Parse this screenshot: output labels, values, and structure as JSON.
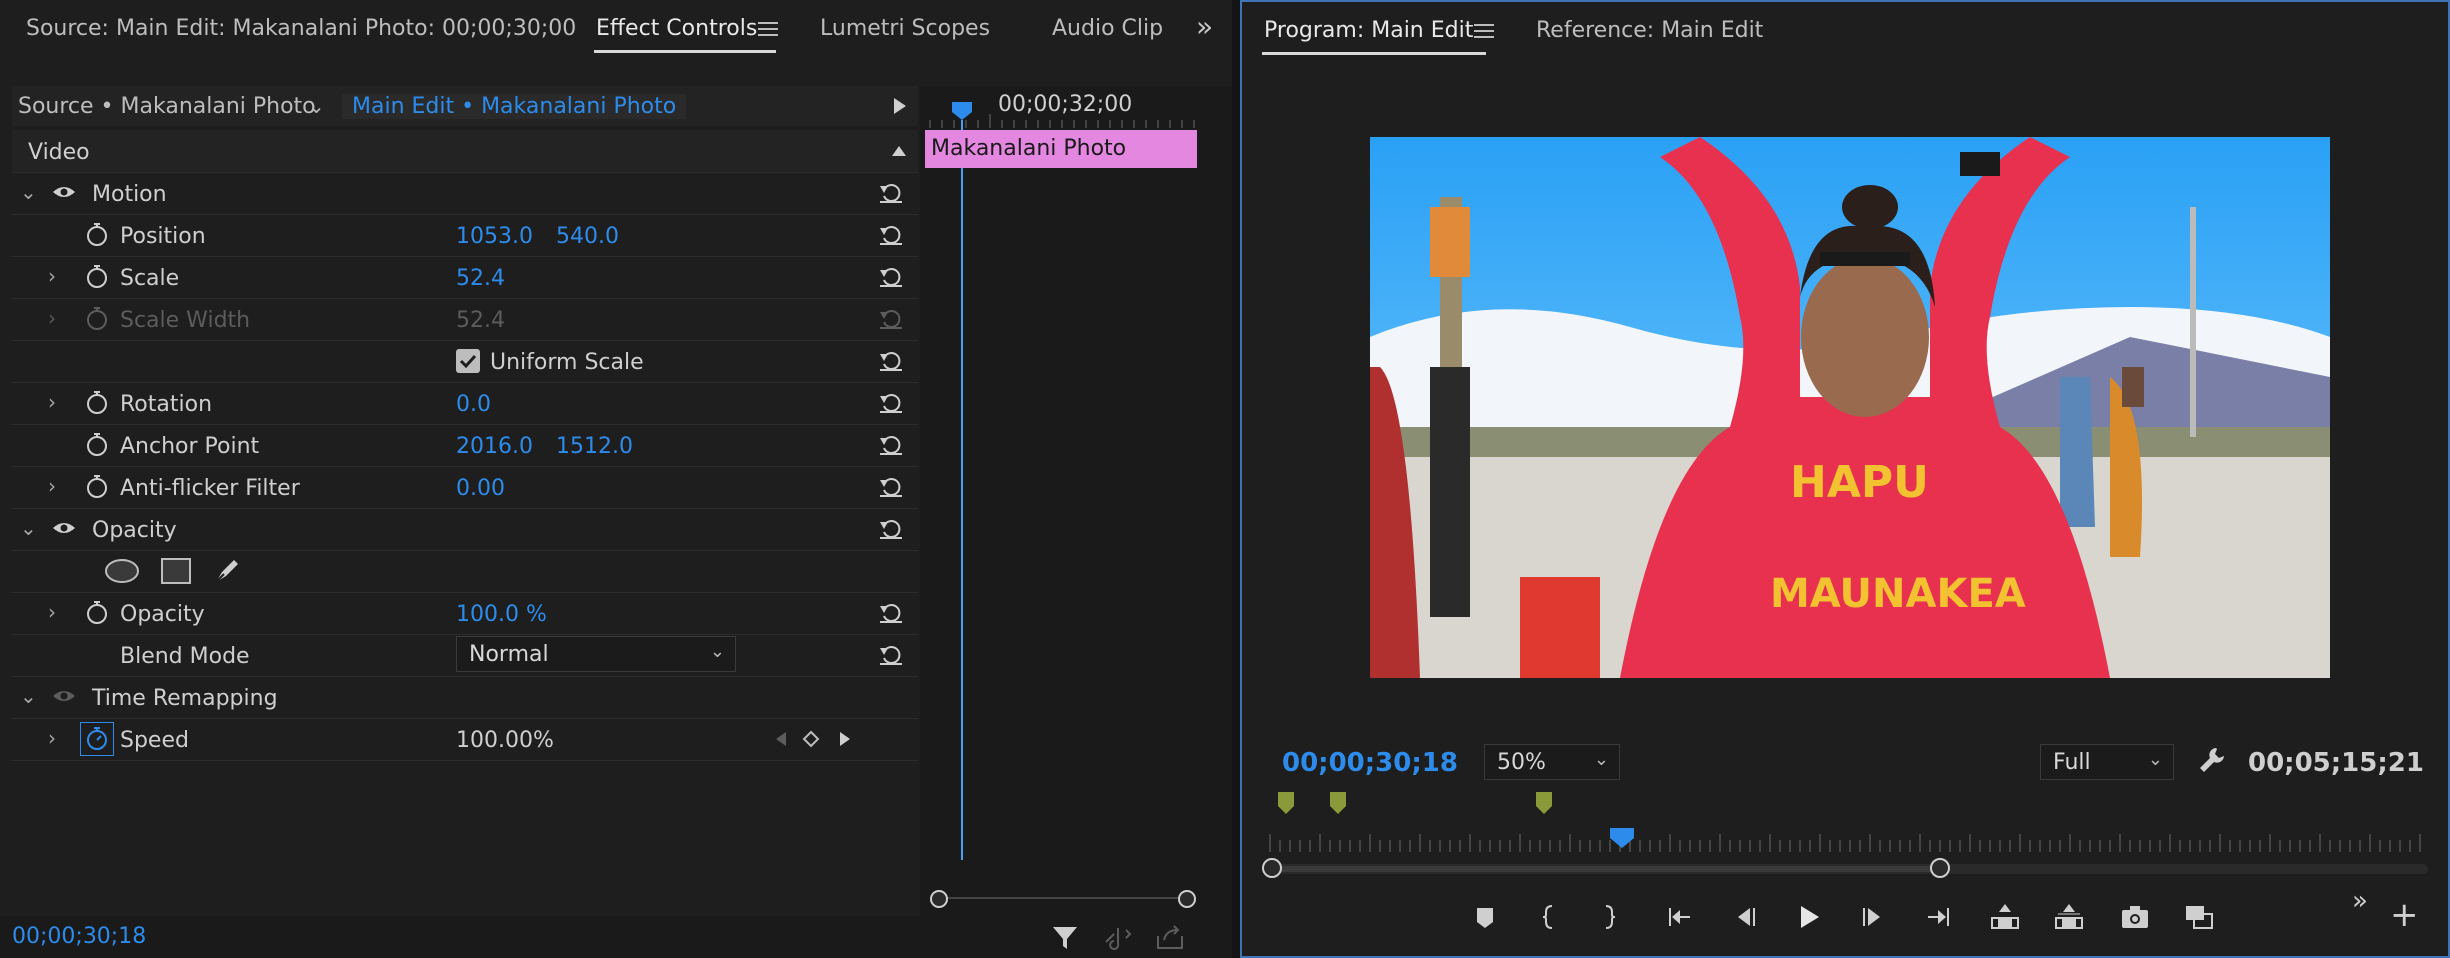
{
  "left_panel": {
    "tabs": [
      {
        "label": "Source: Main Edit: Makanalani Photo: 00;00;30;00",
        "active": false
      },
      {
        "label": "Effect Controls",
        "active": true
      },
      {
        "label": "Lumetri Scopes",
        "active": false
      },
      {
        "label": "Audio Clip",
        "active": false
      }
    ],
    "overflow_icon": "double-chevron-right-icon",
    "source_label": "Source • Makanalani Photo",
    "sequence_label": "Main Edit • Makanalani Photo",
    "section_video": "Video",
    "effects": {
      "motion": {
        "label": "Motion",
        "position": {
          "label": "Position",
          "x": "1053.0",
          "y": "540.0"
        },
        "scale": {
          "label": "Scale",
          "value": "52.4"
        },
        "scale_width": {
          "label": "Scale Width",
          "value": "52.4"
        },
        "uniform_scale": {
          "label": "Uniform Scale",
          "checked": true
        },
        "rotation": {
          "label": "Rotation",
          "value": "0.0"
        },
        "anchor_point": {
          "label": "Anchor Point",
          "x": "2016.0",
          "y": "1512.0"
        },
        "anti_flicker": {
          "label": "Anti-flicker Filter",
          "value": "0.00"
        }
      },
      "opacity": {
        "label": "Opacity",
        "opacity": {
          "label": "Opacity",
          "value": "100.0 %"
        },
        "blend_mode": {
          "label": "Blend Mode",
          "value": "Normal"
        }
      },
      "time_remapping": {
        "label": "Time Remapping",
        "speed": {
          "label": "Speed",
          "value": "100.00%"
        }
      }
    },
    "timeline": {
      "timecode": "00;00;32;00",
      "clip_label": "Makanalani Photo",
      "clip_color": "#e487e0"
    },
    "current_timecode": "00;00;30;18"
  },
  "right_panel": {
    "tabs": [
      {
        "label": "Program: Main Edit",
        "active": true
      },
      {
        "label": "Reference: Main Edit",
        "active": false
      }
    ],
    "current_timecode": "00;00;30;18",
    "zoom": "50%",
    "resolution": "Full",
    "duration": "00;05;15;21",
    "colors": {
      "accent": "#2d8ceb",
      "marker": "#8a9a3a",
      "border": "#3f73b5"
    }
  }
}
